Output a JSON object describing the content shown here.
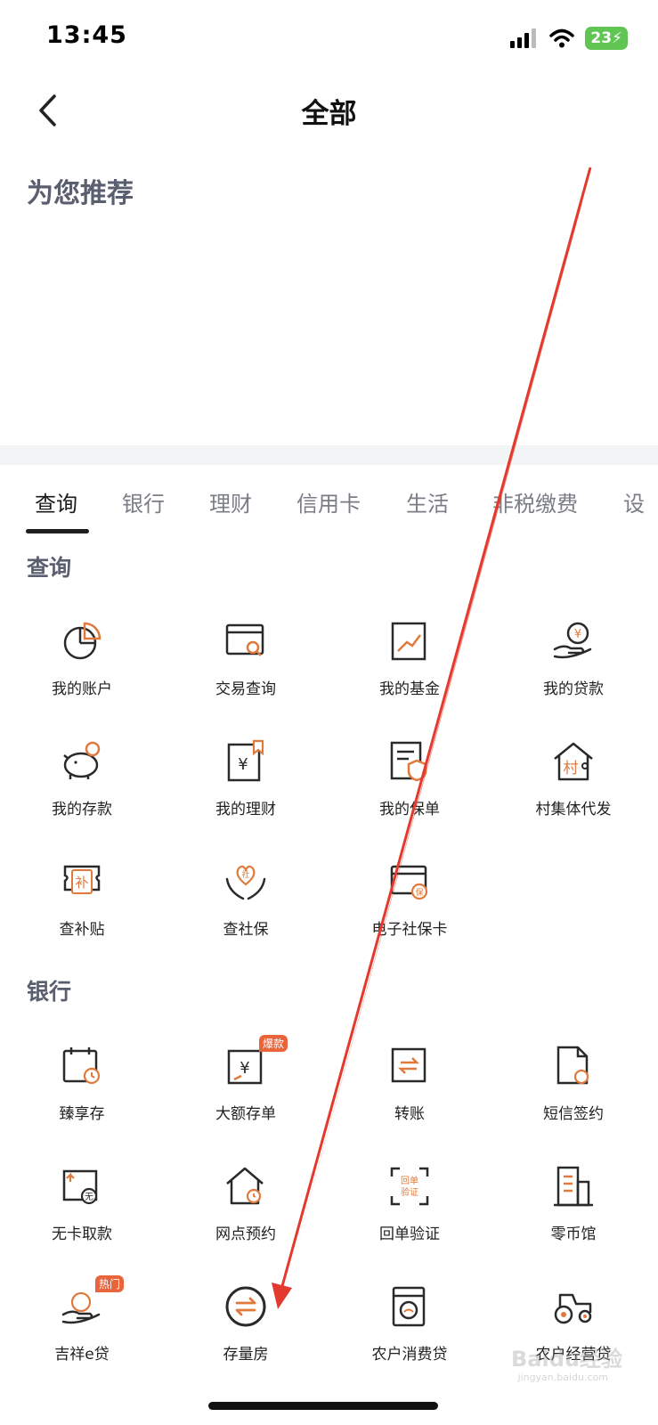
{
  "status": {
    "time": "13:45",
    "battery": "23"
  },
  "nav": {
    "title": "全部"
  },
  "recommend": {
    "title": "为您推荐"
  },
  "tabs": [
    {
      "label": "查询"
    },
    {
      "label": "银行"
    },
    {
      "label": "理财"
    },
    {
      "label": "信用卡"
    },
    {
      "label": "生活"
    },
    {
      "label": "非税缴费"
    },
    {
      "label": "设"
    }
  ],
  "sections": {
    "query": {
      "title": "查询",
      "items": [
        {
          "label": "我的账户",
          "icon": "pie-chart-icon"
        },
        {
          "label": "交易查询",
          "icon": "card-search-icon"
        },
        {
          "label": "我的基金",
          "icon": "trend-chart-icon"
        },
        {
          "label": "我的贷款",
          "icon": "hand-yuan-icon"
        },
        {
          "label": "我的存款",
          "icon": "piggy-bank-icon"
        },
        {
          "label": "我的理财",
          "icon": "yuan-document-icon"
        },
        {
          "label": "我的保单",
          "icon": "policy-shield-icon"
        },
        {
          "label": "村集体代发",
          "icon": "village-house-icon"
        },
        {
          "label": "查补贴",
          "icon": "subsidy-ticket-icon"
        },
        {
          "label": "查社保",
          "icon": "heart-hands-icon"
        },
        {
          "label": "电子社保卡",
          "icon": "social-card-icon"
        }
      ],
      "icon_text": {
        "village": "村",
        "subsidy": "补",
        "social": "社",
        "card": "保"
      }
    },
    "bank": {
      "title": "银行",
      "items": [
        {
          "label": "臻享存",
          "icon": "calendar-clock-icon"
        },
        {
          "label": "大额存单",
          "icon": "deposit-cert-icon",
          "badge": "爆款"
        },
        {
          "label": "转账",
          "icon": "transfer-icon"
        },
        {
          "label": "短信签约",
          "icon": "sms-doc-icon"
        },
        {
          "label": "无卡取款",
          "icon": "cardless-icon"
        },
        {
          "label": "网点预约",
          "icon": "branch-clock-icon"
        },
        {
          "label": "回单验证",
          "icon": "receipt-scan-icon"
        },
        {
          "label": "零币馆",
          "icon": "building-icon"
        },
        {
          "label": "吉祥e贷",
          "icon": "loan-hand-icon",
          "badge": "热门"
        },
        {
          "label": "存量房",
          "icon": "swap-circle-icon"
        },
        {
          "label": "农户消费贷",
          "icon": "washer-icon"
        },
        {
          "label": "农户经营贷",
          "icon": "tractor-icon"
        }
      ],
      "icon_text": {
        "cardless": "无",
        "receipt_top": "回单",
        "receipt_bottom": "验证"
      }
    }
  },
  "colors": {
    "accent": "#e07a3c",
    "stroke": "#2a2a2a",
    "annotation": "#e23a2e"
  },
  "watermark": {
    "brand": "Baidu经验",
    "url": "jingyan.baidu.com"
  }
}
